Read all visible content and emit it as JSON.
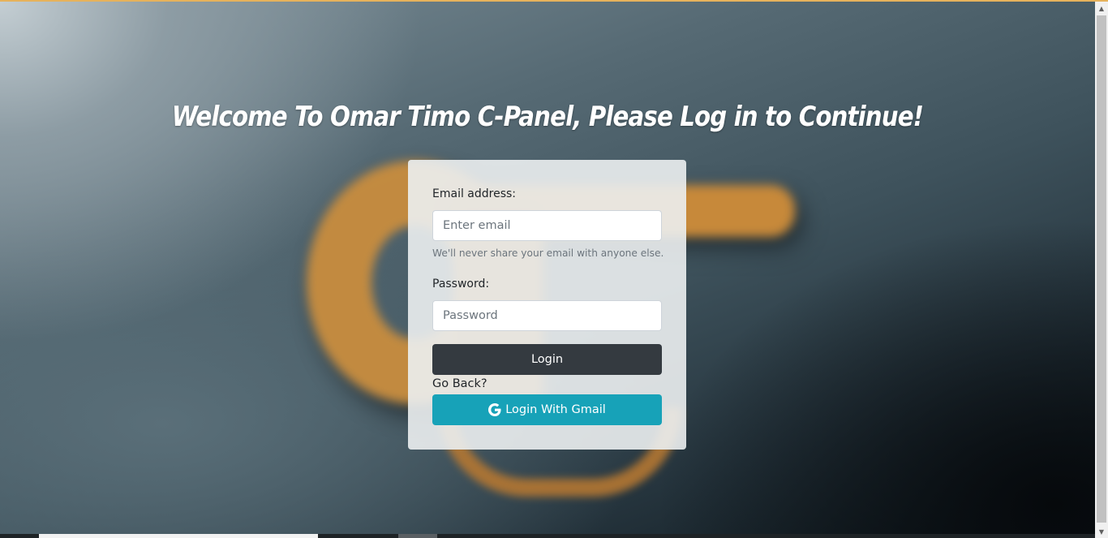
{
  "page": {
    "title": "Welcome To Omar Timo C-Panel, Please Log in to Continue!"
  },
  "form": {
    "email_label": "Email address:",
    "email_placeholder": "Enter email",
    "email_value": "",
    "email_help": "We'll never share your email with anyone else.",
    "password_label": "Password:",
    "password_placeholder": "Password",
    "password_value": "",
    "login_label": "Login",
    "go_back_label": "Go Back?",
    "gmail_label": "Login With Gmail"
  },
  "icons": {
    "gmail_button": "google-icon",
    "scroll_up": "scroll-up-arrow-icon",
    "scroll_down": "scroll-down-arrow-icon"
  },
  "colors": {
    "login_button": "#343a40",
    "gmail_button": "#17a2b8",
    "card_background": "#eceff1",
    "logo_gold": "#c98d3e"
  }
}
